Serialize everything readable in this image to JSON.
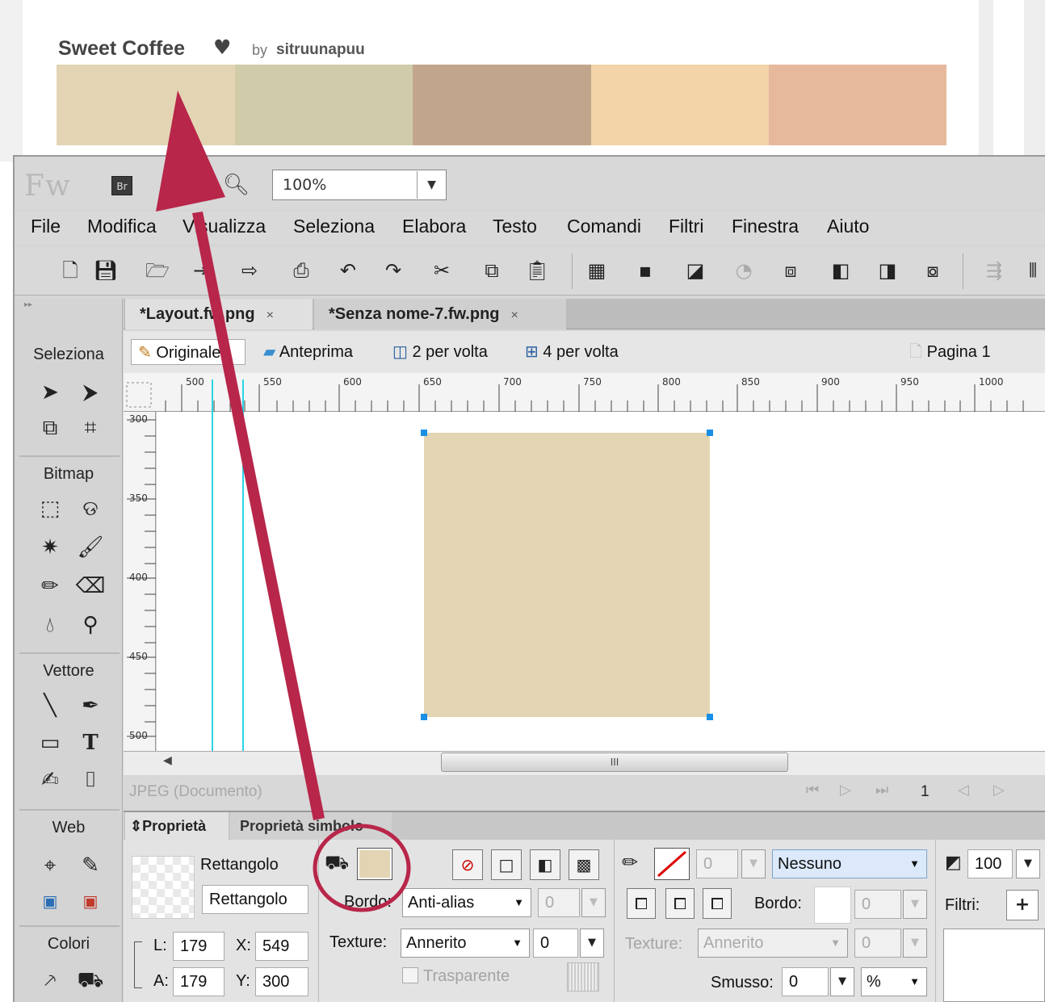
{
  "palette": {
    "title": "Sweet Coffee",
    "heart": "♥",
    "by": "by",
    "author": "sitruunapuu",
    "swatches": [
      "#e3d5b3",
      "#d0cba9",
      "#c2a68b",
      "#f2d4a8",
      "#e6b99d"
    ]
  },
  "app": {
    "logo": "Fw",
    "bridge_label": "Br",
    "zoom_value": "100%"
  },
  "menu": [
    "File",
    "Modifica",
    "Visualizza",
    "Seleziona",
    "Elabora",
    "Testo",
    "Comandi",
    "Filtri",
    "Finestra",
    "Aiuto"
  ],
  "tools": {
    "sections": {
      "select": "Seleziona",
      "bitmap": "Bitmap",
      "vector": "Vettore",
      "web": "Web",
      "colors": "Colori"
    }
  },
  "documents": {
    "tabs": [
      {
        "label": "*Layout.fw.png",
        "close": "×"
      },
      {
        "label": "*Senza nome-7.fw.png",
        "close": "×"
      }
    ]
  },
  "view": {
    "original": "Originale",
    "preview": "Anteprima",
    "two_up": "2 per volta",
    "four_up": "4 per volta",
    "page": "Pagina 1"
  },
  "ruler": {
    "h_ticks": [
      "500",
      "550",
      "600",
      "650",
      "700",
      "750",
      "800",
      "850",
      "900",
      "950",
      "1000"
    ],
    "v_ticks": [
      "300",
      "350",
      "400",
      "450",
      "500"
    ]
  },
  "canvas": {
    "rect_fill": "#e3d5b3",
    "guide_color": "#2bd4e6"
  },
  "scrollbar": {
    "thumb_grip": "III"
  },
  "status": {
    "format": "JPEG (Documento)",
    "frame": "1"
  },
  "properties": {
    "tabs": [
      "Proprietà",
      "Proprietà simbolo"
    ],
    "object_type": "Rettangolo",
    "object_name": "Rettangolo",
    "size": {
      "L_label": "L:",
      "L": "179",
      "A_label": "A:",
      "A": "179"
    },
    "position": {
      "X_label": "X:",
      "X": "549",
      "Y_label": "Y:",
      "Y": "300"
    },
    "fill": {
      "color": "#e3d5b3",
      "edge_label": "Bordo:",
      "edge_value": "Anti-alias",
      "edge_amount": "0",
      "texture_label": "Texture:",
      "texture_value": "Annerito",
      "texture_amount": "0",
      "transparent_label": "Trasparente"
    },
    "stroke": {
      "size": "0",
      "category": "Nessuno",
      "edge_label": "Bordo:",
      "edge_amount": "0",
      "texture_label": "Texture:",
      "texture_value": "Annerito",
      "texture_amount": "0",
      "rounding_label": "Smusso:",
      "rounding_value": "0",
      "rounding_unit": "%"
    },
    "opacity": "100",
    "filters_label": "Filtri:",
    "add_filter": "+"
  }
}
